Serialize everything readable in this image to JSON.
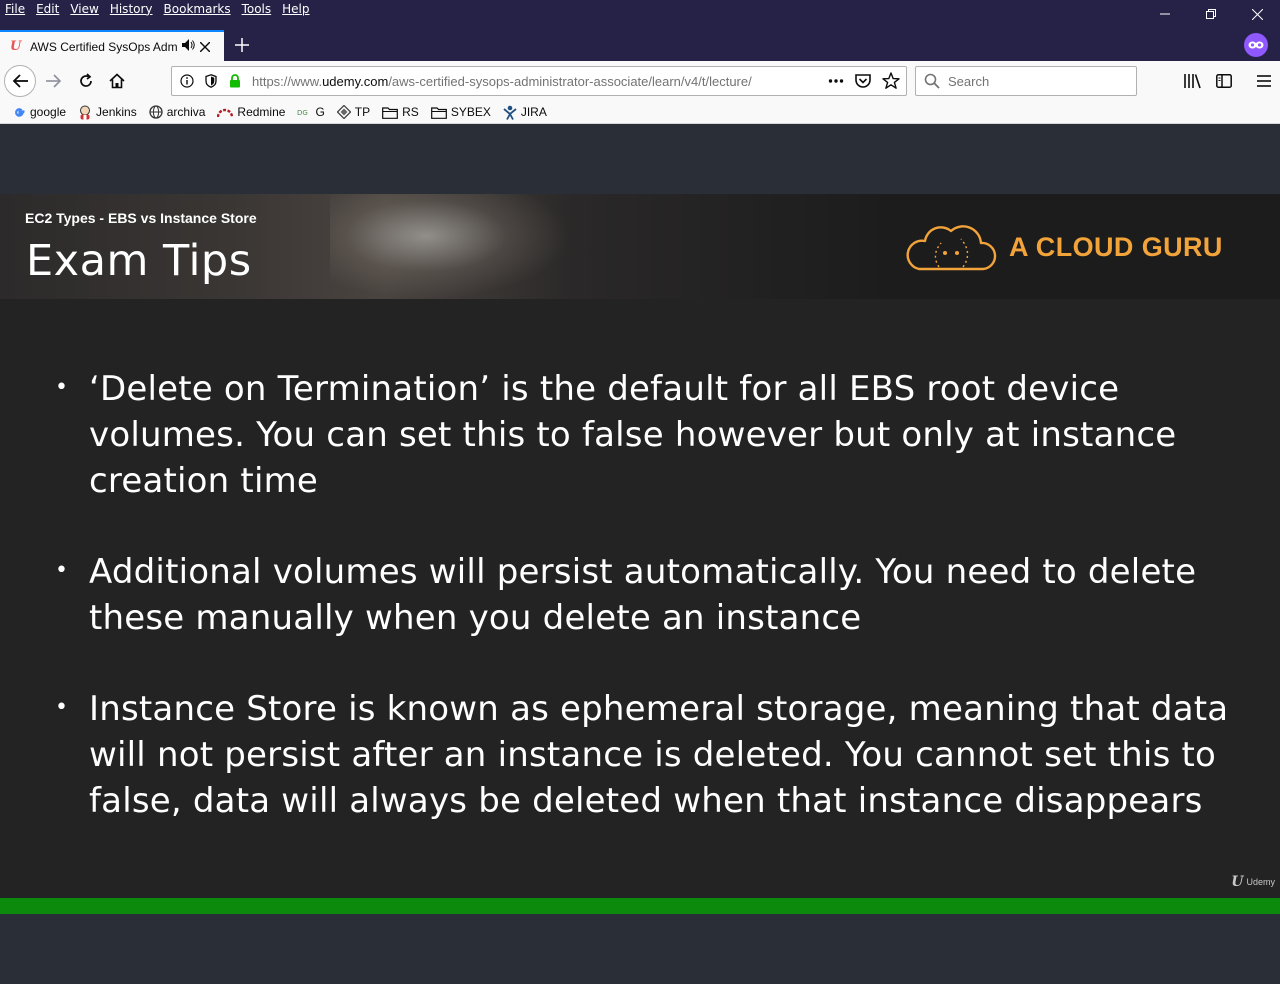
{
  "menubar": {
    "items": [
      "File",
      "Edit",
      "View",
      "History",
      "Bookmarks",
      "Tools",
      "Help"
    ]
  },
  "tab": {
    "title": "AWS Certified SysOps Administrator",
    "favicon": "U",
    "audio_icon": "speaker-icon"
  },
  "navigation": {
    "url_prefix": "https://www.",
    "url_domain": "udemy.com",
    "url_path": "/aws-certified-sysops-administrator-associate/learn/v4/t/lecture/",
    "search_placeholder": "Search"
  },
  "bookmarks": [
    {
      "label": "google",
      "icon": "google-icon"
    },
    {
      "label": "Jenkins",
      "icon": "jenkins-icon"
    },
    {
      "label": "archiva",
      "icon": "globe-icon"
    },
    {
      "label": "Redmine",
      "icon": "redmine-icon"
    },
    {
      "label": "G",
      "icon": "dg-icon"
    },
    {
      "label": "TP",
      "icon": "diamond-icon"
    },
    {
      "label": "RS",
      "icon": "folder-icon"
    },
    {
      "label": "SYBEX",
      "icon": "folder-icon"
    },
    {
      "label": "JIRA",
      "icon": "jira-icon"
    }
  ],
  "slide": {
    "subtitle": "EC2 Types - EBS vs Instance Store",
    "heading": "Exam Tips",
    "brand": "A CLOUD GURU",
    "bullets": [
      "‘Delete on Termination’ is the default for all EBS root device volumes. You can set this to false however but only at instance creation time",
      "Additional volumes will persist automatically. You need to delete these manually when you delete an instance",
      "Instance Store is known as ephemeral storage, meaning that data will not persist after an instance is deleted. You cannot set this to false, data will always be deleted when that instance disappears"
    ],
    "watermark": "Udemy",
    "watermark_glyph": "U"
  },
  "player": {
    "progress_percent": 100
  },
  "colors": {
    "menubar": "#262147",
    "brand": "#f2a33a",
    "progress": "#0c8a0c",
    "accent": "#0a84ff"
  }
}
